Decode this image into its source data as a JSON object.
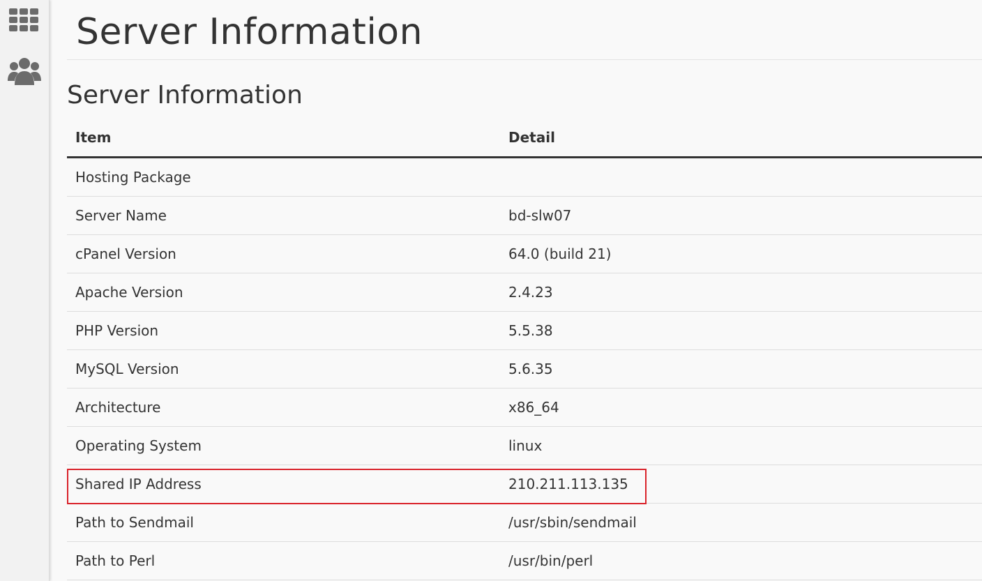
{
  "sidebar": {
    "items": [
      {
        "icon": "grid-icon",
        "name": "apps"
      },
      {
        "icon": "users-icon",
        "name": "users"
      }
    ]
  },
  "page": {
    "title": "Server Information"
  },
  "section": {
    "title": "Server Information"
  },
  "table": {
    "headers": {
      "item": "Item",
      "detail": "Detail"
    },
    "rows": [
      {
        "item": "Hosting Package",
        "detail": ""
      },
      {
        "item": "Server Name",
        "detail": "bd-slw07"
      },
      {
        "item": "cPanel Version",
        "detail": "64.0 (build 21)"
      },
      {
        "item": "Apache Version",
        "detail": "2.4.23"
      },
      {
        "item": "PHP Version",
        "detail": "5.5.38"
      },
      {
        "item": "MySQL Version",
        "detail": "5.6.35"
      },
      {
        "item": "Architecture",
        "detail": "x86_64"
      },
      {
        "item": "Operating System",
        "detail": "linux"
      },
      {
        "item": "Shared IP Address",
        "detail": "210.211.113.135"
      },
      {
        "item": "Path to Sendmail",
        "detail": "/usr/sbin/sendmail"
      },
      {
        "item": "Path to Perl",
        "detail": "/usr/bin/perl"
      }
    ]
  },
  "colors": {
    "highlight": "#d9222a",
    "icon": "#6b6b6b"
  }
}
